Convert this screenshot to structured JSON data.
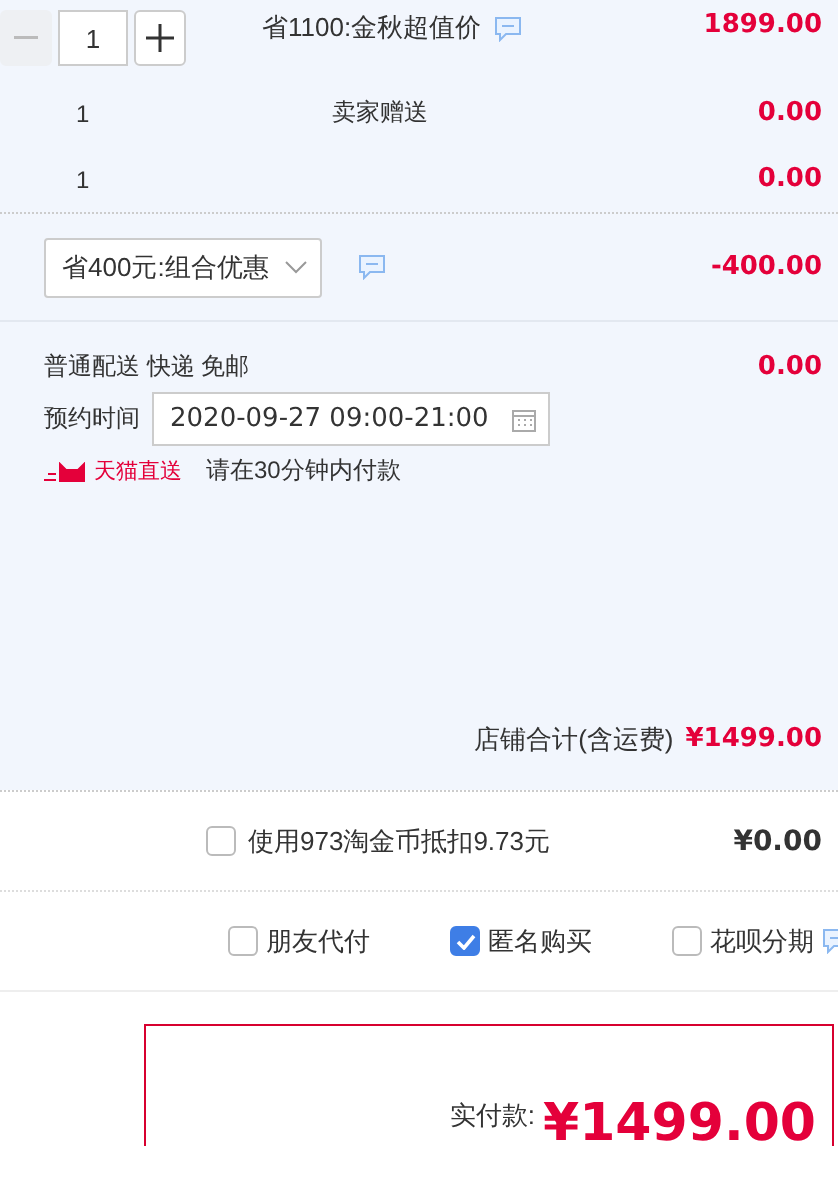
{
  "item": {
    "quantity": "1",
    "minus_disabled": true,
    "promotion": "省1100:金秋超值价",
    "price": "1899.00"
  },
  "gifts": [
    {
      "quantity": "1",
      "name": "卖家赠送",
      "price": "0.00"
    },
    {
      "quantity": "1",
      "price": "0.00"
    }
  ],
  "discount": {
    "selected_option": "省400元:组合优惠",
    "amount": "-400.00"
  },
  "delivery": {
    "method": "普通配送 快递 免邮",
    "fee": "0.00",
    "time_label": "预约时间",
    "time_value": "2020-09-27 09:00-21:00",
    "badge": "天猫直送",
    "note": "请在30分钟内付款"
  },
  "store_total": {
    "label": "店铺合计(含运费)",
    "amount": "¥1499.00"
  },
  "coins": {
    "label": "使用973淘金币抵扣9.73元",
    "checked": false,
    "amount": "¥0.00"
  },
  "options": [
    {
      "label": "朋友代付",
      "checked": false
    },
    {
      "label": "匿名购买",
      "checked": true
    },
    {
      "label": "花呗分期",
      "checked": false,
      "info": true
    }
  ],
  "payment": {
    "label": "实付款:",
    "amount": "¥1499.00"
  }
}
